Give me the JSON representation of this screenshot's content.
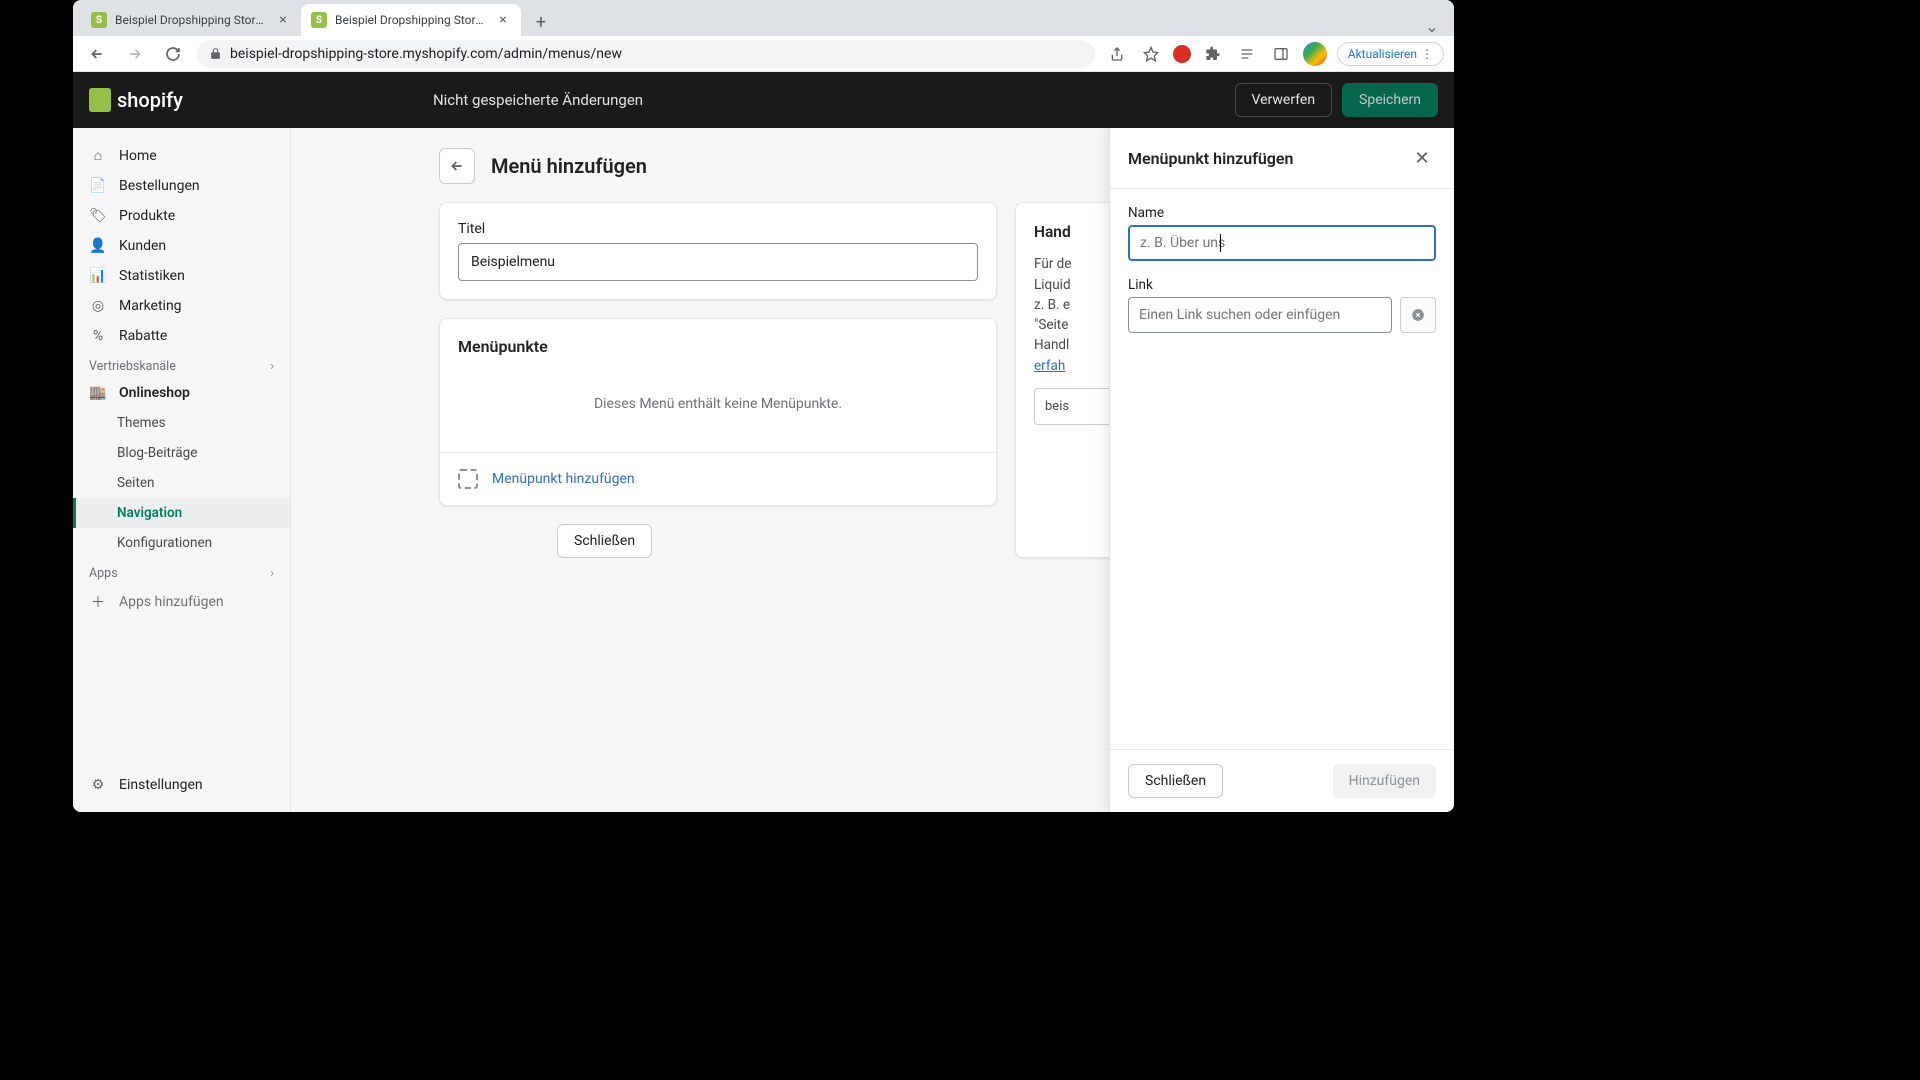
{
  "browser": {
    "tabs": [
      {
        "title": "Beispiel Dropshipping Store · D"
      },
      {
        "title": "Beispiel Dropshipping Store · N"
      }
    ],
    "url": "beispiel-dropshipping-store.myshopify.com/admin/menus/new",
    "update_label": "Aktualisieren"
  },
  "topbar": {
    "brand": "shopify",
    "unsaved_msg": "Nicht gespeicherte Änderungen",
    "discard": "Verwerfen",
    "save": "Speichern"
  },
  "sidebar": {
    "home": "Home",
    "orders": "Bestellungen",
    "products": "Produkte",
    "customers": "Kunden",
    "analytics": "Statistiken",
    "marketing": "Marketing",
    "discounts": "Rabatte",
    "channels_header": "Vertriebskanäle",
    "onlineshop": "Onlineshop",
    "themes": "Themes",
    "blogs": "Blog-Beiträge",
    "pages": "Seiten",
    "navigation": "Navigation",
    "config": "Konfigurationen",
    "apps_header": "Apps",
    "add_apps": "Apps hinzufügen",
    "settings": "Einstellungen"
  },
  "page": {
    "title": "Menü hinzufügen",
    "title_field_label": "Titel",
    "title_field_value": "Beispielmenu",
    "menupoints_heading": "Menüpunkte",
    "empty_text": "Dieses Menü enthält keine Menüpunkte.",
    "add_item_label": "Menüpunkt hinzufügen",
    "close_button": "Schließen",
    "handle_heading": "Hand",
    "handle_body": "Für de\nLiquid\nz. B. e\n\"Seite\nHandl",
    "handle_link": "erfah",
    "handle_value": "beis"
  },
  "panel": {
    "title": "Menüpunkt hinzufügen",
    "name_label": "Name",
    "name_placeholder": "z. B. Über uns",
    "link_label": "Link",
    "link_placeholder": "Einen Link suchen oder einfügen",
    "close": "Schließen",
    "add": "Hinzufügen"
  }
}
